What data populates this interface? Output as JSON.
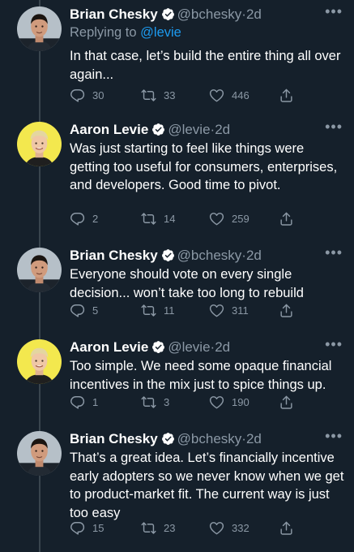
{
  "tweets": [
    {
      "name": "Brian Chesky",
      "handle": "@bchesky",
      "sep": "·",
      "time": "2d",
      "reply_prefix": "Replying to",
      "reply_to": "@levie",
      "text": "In that case, let’s build the entire thing all over again...",
      "replies": "30",
      "retweets": "33",
      "likes": "446",
      "avatar": "brian"
    },
    {
      "name": "Aaron Levie",
      "handle": "@levie",
      "sep": "·",
      "time": "2d",
      "text": "Was just starting to feel like things were getting too useful for consumers, enterprises, and developers. Good time to pivot.",
      "replies": "2",
      "retweets": "14",
      "likes": "259",
      "avatar": "aaron"
    },
    {
      "name": "Brian Chesky",
      "handle": "@bchesky",
      "sep": "·",
      "time": "2d",
      "text": "Everyone should vote on every single decision... won’t take too long to rebuild",
      "replies": "5",
      "retweets": "11",
      "likes": "311",
      "avatar": "brian"
    },
    {
      "name": "Aaron Levie",
      "handle": "@levie",
      "sep": "·",
      "time": "2d",
      "text": "Too simple. We need some opaque financial incentives in the mix just to spice things up.",
      "replies": "1",
      "retweets": "3",
      "likes": "190",
      "avatar": "aaron"
    },
    {
      "name": "Brian Chesky",
      "handle": "@bchesky",
      "sep": "·",
      "time": "2d",
      "text": "That’s a great idea. Let’s financially incentive early adopters so we never know when we get to product-market fit. The current way is just too easy",
      "replies": "15",
      "retweets": "23",
      "likes": "332",
      "avatar": "brian"
    }
  ],
  "icons": {
    "more": "more-icon",
    "verified": "verified-badge-icon",
    "reply": "reply-icon",
    "retweet": "retweet-icon",
    "like": "heart-icon",
    "share": "share-icon"
  },
  "colors": {
    "background": "#15202b",
    "muted": "#8b98a5",
    "accent": "#1d9bf0",
    "thread_line": "#38444d"
  }
}
